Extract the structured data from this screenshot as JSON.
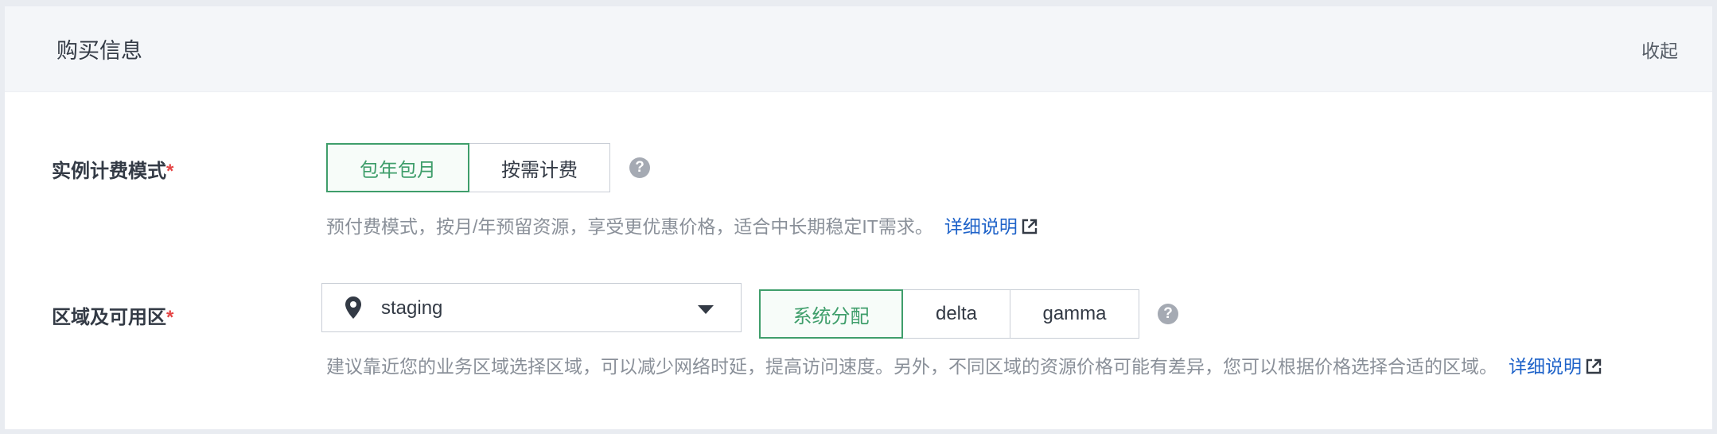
{
  "panel": {
    "title": "购买信息",
    "collapse_label": "收起"
  },
  "billing": {
    "label": "实例计费模式",
    "required_mark": "*",
    "options": [
      {
        "label": "包年包月",
        "selected": true
      },
      {
        "label": "按需计费",
        "selected": false
      }
    ],
    "help_icon": "?",
    "hint": "预付费模式，按月/年预留资源，享受更优惠价格，适合中长期稳定IT需求。",
    "link_label": "详细说明"
  },
  "region": {
    "label": "区域及可用区",
    "required_mark": "*",
    "select_value": "staging",
    "zones": [
      {
        "label": "系统分配",
        "selected": true
      },
      {
        "label": "delta",
        "selected": false
      },
      {
        "label": "gamma",
        "selected": false
      }
    ],
    "help_icon": "?",
    "hint": "建议靠近您的业务区域选择区域，可以减少网络时延，提高访问速度。另外，不同区域的资源价格可能有差异，您可以根据价格选择合适的区域。",
    "link_label": "详细说明"
  },
  "colors": {
    "accent_green": "#3f9e6b",
    "link_blue": "#1f63c9",
    "required_red": "#e54545"
  }
}
